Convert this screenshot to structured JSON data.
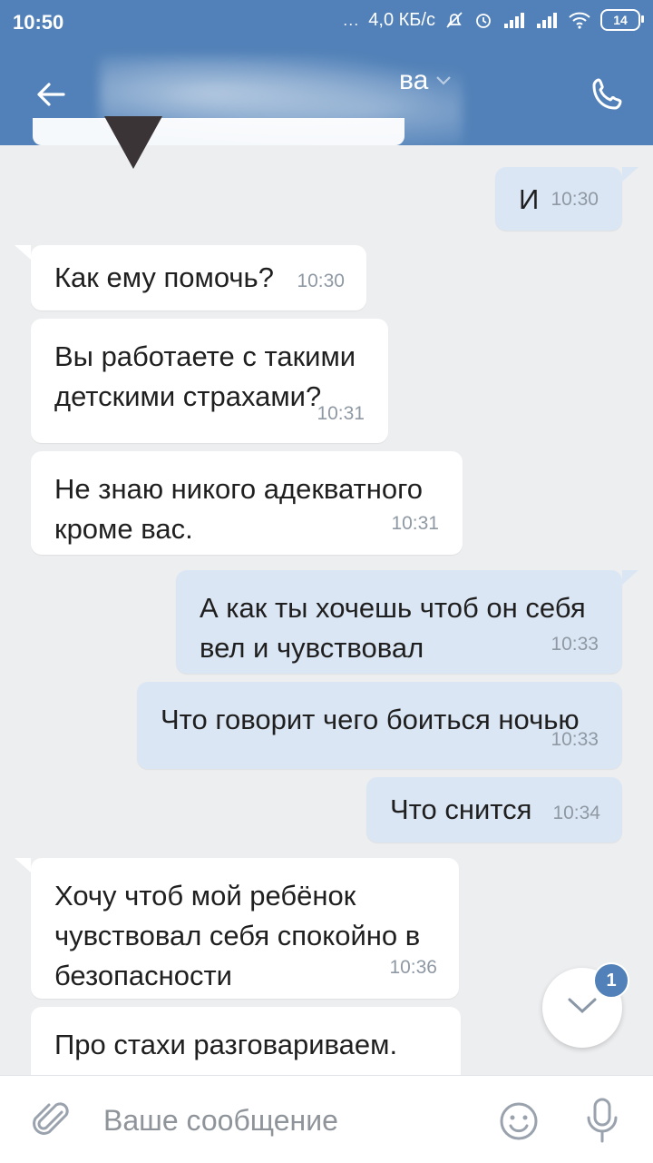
{
  "status_bar": {
    "time": "10:50",
    "dots": "...",
    "speed": "4,0 КБ/с",
    "battery": "14"
  },
  "header": {
    "name_fragment": "ва",
    "back_icon": "back-arrow-icon",
    "call_icon": "phone-icon"
  },
  "messages": [
    {
      "dir": "out",
      "text": "И",
      "time": "10:30"
    },
    {
      "dir": "in",
      "text": "Как ему помочь?",
      "time": "10:30"
    },
    {
      "dir": "in",
      "text": "Вы работаете с такими\nдетскими страхами?",
      "time": "10:31"
    },
    {
      "dir": "in",
      "text": "Не знаю никого адекватного\nкроме вас.",
      "time": "10:31"
    },
    {
      "dir": "out",
      "text": "А как ты хочешь чтоб он себя\nвел и чувствовал",
      "time": "10:33"
    },
    {
      "dir": "out",
      "text": "Что говорит чего боиться ночью",
      "time": "10:33"
    },
    {
      "dir": "out",
      "text": "Что снится",
      "time": "10:34"
    },
    {
      "dir": "in",
      "text": "Хочу чтоб мой ребёнок\nчувствовал себя спокойно в\nбезопасности",
      "time": "10:36"
    },
    {
      "dir": "in",
      "text": "Про стахи разговариваем.",
      "time": ""
    }
  ],
  "scroll_button": {
    "badge": "1"
  },
  "composer": {
    "placeholder": "Ваше сообщение"
  },
  "colors": {
    "header": "#5181b8",
    "outgoing_bubble": "#dbe6f4",
    "incoming_bubble": "#ffffff",
    "background": "#edeef0"
  }
}
